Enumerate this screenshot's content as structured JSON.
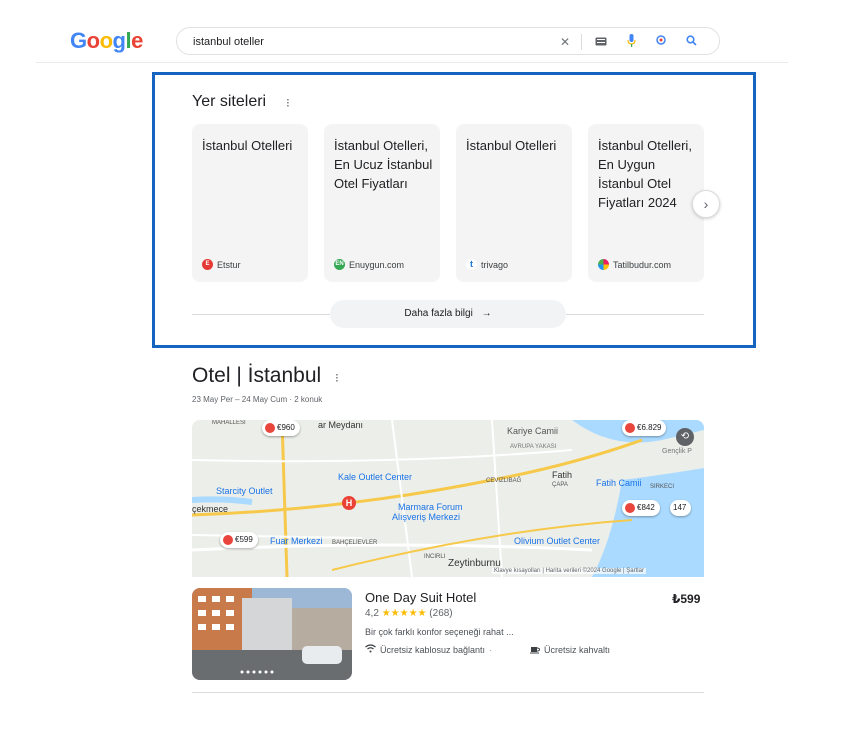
{
  "logo": {
    "letters": [
      "G",
      "o",
      "o",
      "g",
      "l",
      "e"
    ]
  },
  "search": {
    "query": "istanbul oteller",
    "icons": [
      "close-icon",
      "keyboard-icon",
      "mic-icon",
      "lens-icon",
      "search-icon"
    ]
  },
  "places": {
    "title": "Yer siteleri",
    "cards": [
      {
        "title": "İstanbul Otelleri",
        "source": "Etstur",
        "color": "#e53935"
      },
      {
        "title": "İstanbul Otelleri, En Ucuz İstanbul Otel Fiyatları",
        "source": "Enuygun.com",
        "color": "#34a853"
      },
      {
        "title": "İstanbul Otelleri",
        "source": "trivago",
        "color": "#1976d2"
      },
      {
        "title": "İstanbul Otelleri, En Uygun İstanbul Otel Fiyatları 2024",
        "source": "Tatilbudur.com",
        "color": "#e91e63"
      }
    ],
    "more_label": "Daha fazla bilgi",
    "more_arrow": "→",
    "next_icon": "›"
  },
  "hotels": {
    "title": "Otel | İstanbul",
    "dates": "23 May Per – 24 May Cum · 2 konuk",
    "map": {
      "labels": [
        "Kariye Camii",
        "AVRUPA YAKASI",
        "Kale Outlet Center",
        "Fatih",
        "ÇAPA",
        "Fatih Camii",
        "Starcity Outlet",
        "Marmara Forum",
        "Alışveriş Merkezi",
        "çekmece",
        "Fuar Merkezi",
        "Olivium Outlet Center",
        "Zeytinburnu",
        "BAHÇELİEVLER",
        "INCIRLI",
        "CEVIZLIBAĞ",
        "SIRKECI",
        "MAHALLESI",
        "Gençlik P",
        "ar Meydanı"
      ],
      "pins": [
        "€960",
        "€6.829",
        "€842",
        "€599",
        "147"
      ],
      "attribution": "Klavye kısayolları | Harita verileri ©2024 Google | Şartlar"
    },
    "items": [
      {
        "name": "One Day Suit Hotel",
        "price": "₺599",
        "rating": "4,2",
        "stars": "★★★★★",
        "reviews": "(268)",
        "description": "Bir çok farklı konfor seçeneği rahat ...",
        "amenity1": "Ücretsiz kablosuz bağlantı",
        "amenity2": "Ücretsiz kahvaltı"
      }
    ]
  }
}
